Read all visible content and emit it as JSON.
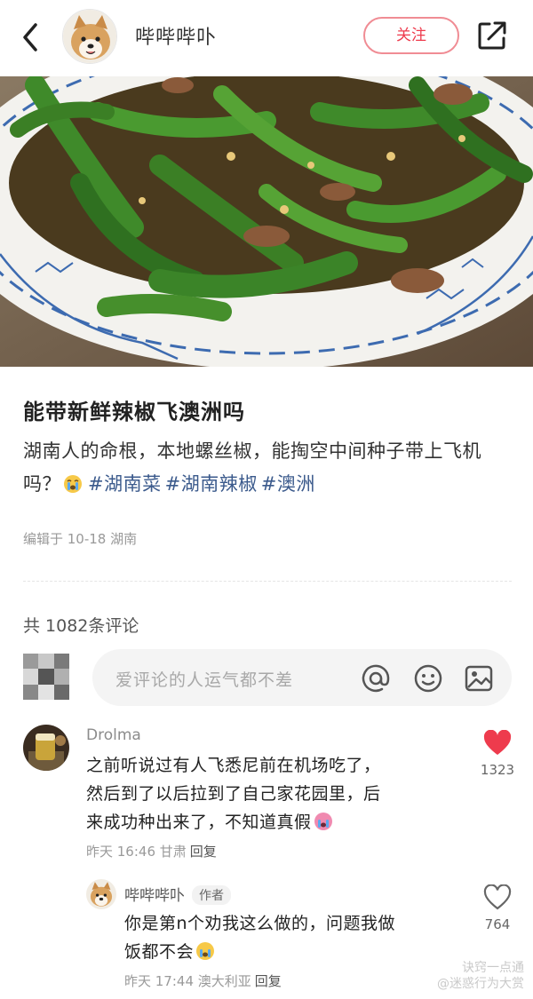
{
  "header": {
    "author_name": "哔哔哔卟",
    "follow_label": "关注"
  },
  "post": {
    "title": "能带新鲜辣椒飞澳洲吗",
    "body": "湖南人的命根，本地螺丝椒，能掏空中间种子带上飞机吗？",
    "tags": [
      "#湖南菜",
      "#湖南辣椒",
      "#澳洲"
    ],
    "edited": "编辑于 10-18 湖南"
  },
  "comments": {
    "count_label": "共 1082条评论",
    "input_placeholder": "爱评论的人运气都不差",
    "items": [
      {
        "user": "Drolma",
        "text_line1": "之前听说过有人飞悉尼前在机场吃了，",
        "text_line2": "然后到了以后拉到了自己家花园里，后",
        "text_line3": "来成功种出来了，不知道真假",
        "time_loc": "昨天 16:46 甘肃",
        "reply": "回复",
        "likes": "1323"
      },
      {
        "user": "哔哔哔卟",
        "badge": "作者",
        "text_line1": "你是第n个劝我这么做的，问题我做",
        "text_line2": "饭都不会",
        "time_loc": "昨天 17:44 澳大利亚",
        "reply": "回复",
        "likes": "764"
      }
    ]
  },
  "watermark": {
    "line1": "诀窍一点通",
    "line2": "@迷惑行为大赏"
  },
  "colors": {
    "accent_red": "#ee3b4d",
    "tag_blue": "#3b5a8c"
  }
}
